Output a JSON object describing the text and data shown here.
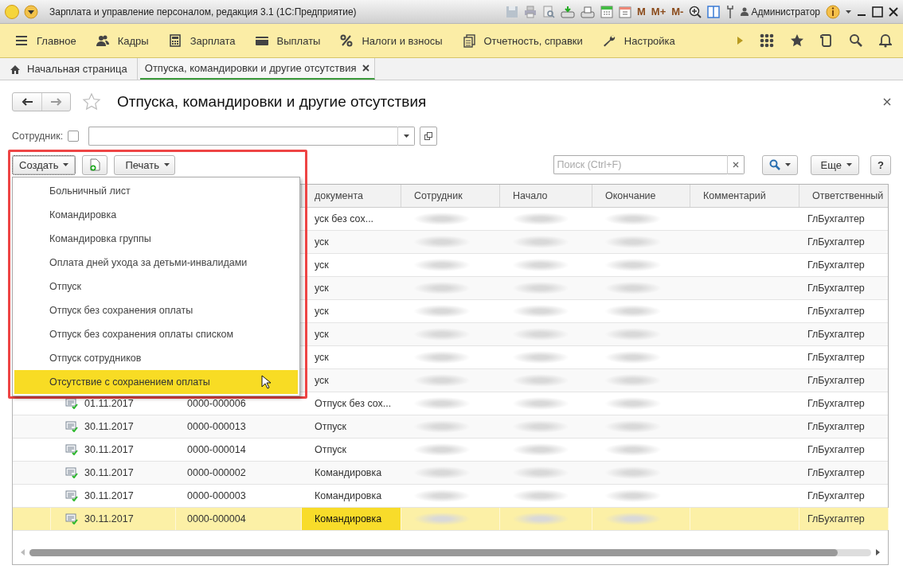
{
  "window": {
    "title": "Зарплата и управление персоналом, редакция 3.1  (1С:Предприятие)",
    "memory_buttons": [
      "M",
      "M+",
      "M-"
    ],
    "user": "Администратор"
  },
  "sections": [
    {
      "label": "Главное",
      "kind": "menu"
    },
    {
      "label": "Кадры",
      "kind": "people"
    },
    {
      "label": "Зарплата",
      "kind": "calculator"
    },
    {
      "label": "Выплаты",
      "kind": "card"
    },
    {
      "label": "Налоги и взносы",
      "kind": "percent"
    },
    {
      "label": "Отчетность, справки",
      "kind": "docs"
    },
    {
      "label": "Настройка",
      "kind": "wrench"
    }
  ],
  "tabs": [
    {
      "label": "Начальная страница",
      "kind": "home",
      "selected": false
    },
    {
      "label": "Отпуска, командировки и другие отсутствия",
      "kind": "page",
      "selected": true
    }
  ],
  "form": {
    "title": "Отпуска, командировки и другие отсутствия",
    "filter": {
      "label": "Сотрудник:",
      "checked": false
    },
    "create_button": "Создать",
    "print_button": "Печать",
    "search": {
      "placeholder": "Поиск (Ctrl+F)"
    },
    "more_button": "Еще",
    "help_button": "?"
  },
  "create_menu": {
    "items": [
      {
        "label": "Больничный лист",
        "selected": false
      },
      {
        "label": "Командировка",
        "selected": false
      },
      {
        "label": "Командировка группы",
        "selected": false
      },
      {
        "label": "Оплата дней ухода за детьми-инвалидами",
        "selected": false
      },
      {
        "label": "Отпуск",
        "selected": false
      },
      {
        "label": "Отпуск без сохранения оплаты",
        "selected": false
      },
      {
        "label": "Отпуск без сохранения оплаты списком",
        "selected": false
      },
      {
        "label": "Отпуск сотрудников",
        "selected": false
      },
      {
        "label": "Отсутствие с сохранением оплаты",
        "selected": true
      }
    ]
  },
  "table": {
    "columns": [
      "документа",
      "Сотрудник",
      "Начало",
      "Окончание",
      "Комментарий",
      "Ответственный"
    ],
    "rows": [
      {
        "type": "уск без сох...",
        "responsible": "ГлБухгалтер",
        "selected": false
      },
      {
        "type": "уск",
        "responsible": "ГлБухгалтер",
        "selected": false
      },
      {
        "type": "уск",
        "responsible": "ГлБухгалтер",
        "selected": false
      },
      {
        "type": "уск",
        "responsible": "ГлБухгалтер",
        "selected": false
      },
      {
        "type": "уск",
        "responsible": "ГлБухгалтер",
        "selected": false
      },
      {
        "type": "уск",
        "responsible": "ГлБухгалтер",
        "selected": false
      },
      {
        "type": "уск",
        "responsible": "ГлБухгалтер",
        "selected": false
      },
      {
        "type": "уск",
        "responsible": "ГлБухгалтер",
        "selected": false
      },
      {
        "date": "01.11.2017",
        "number": "0000-000006",
        "type": "Отпуск без сох...",
        "responsible": "ГлБухгалтер",
        "selected": false
      },
      {
        "date": "30.11.2017",
        "number": "0000-000013",
        "type": "Отпуск",
        "responsible": "ГлБухгалтер",
        "selected": false
      },
      {
        "date": "30.11.2017",
        "number": "0000-000014",
        "type": "Отпуск",
        "responsible": "ГлБухгалтер",
        "selected": false
      },
      {
        "date": "30.11.2017",
        "number": "0000-000002",
        "type": "Командировка",
        "responsible": "ГлБухгалтер",
        "selected": false
      },
      {
        "date": "30.11.2017",
        "number": "0000-000003",
        "type": "Командировка",
        "responsible": "ГлБухгалтер",
        "selected": false
      },
      {
        "date": "30.11.2017",
        "number": "0000-000004",
        "type": "Командировка",
        "responsible": "ГлБухгалтер",
        "selected": true
      }
    ]
  }
}
